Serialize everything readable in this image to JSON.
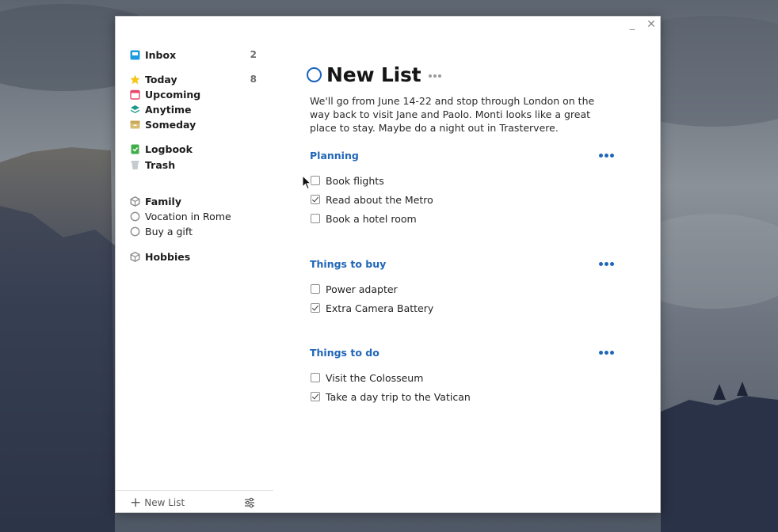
{
  "window": {
    "minimize_glyph": "_",
    "close_glyph": "✕"
  },
  "sidebar": {
    "items": [
      {
        "label": "Inbox",
        "count": "2",
        "icon": "inbox-icon",
        "bold": true
      },
      {
        "label": "Today",
        "count": "8",
        "icon": "star-icon",
        "bold": true
      },
      {
        "label": "Upcoming",
        "count": "",
        "icon": "calendar-icon",
        "bold": true
      },
      {
        "label": "Anytime",
        "count": "",
        "icon": "layers-icon",
        "bold": true
      },
      {
        "label": "Someday",
        "count": "",
        "icon": "archive-box-icon",
        "bold": true
      },
      {
        "label": "Logbook",
        "count": "",
        "icon": "logbook-icon",
        "bold": true
      },
      {
        "label": "Trash",
        "count": "",
        "icon": "trash-icon",
        "bold": true
      },
      {
        "label": "Family",
        "count": "",
        "icon": "area-cube-icon",
        "bold": true
      },
      {
        "label": "Vocation in Rome",
        "count": "",
        "icon": "project-circle-icon",
        "bold": false
      },
      {
        "label": "Buy a gift",
        "count": "",
        "icon": "project-circle-icon",
        "bold": false
      },
      {
        "label": "Hobbies",
        "count": "",
        "icon": "area-cube-icon",
        "bold": true
      }
    ],
    "footer": {
      "new_list_label": "New List",
      "plus_glyph": "+",
      "settings_icon": "sliders-icon"
    }
  },
  "main": {
    "title": "New List",
    "notes": "We'll go from June 14-22 and stop through London on the way back to visit Jane and Paolo. Monti looks like a great place to stay. Maybe do a night out in Trastervere.",
    "headings": [
      {
        "title": "Planning",
        "todos": [
          {
            "label": "Book flights",
            "checked": false
          },
          {
            "label": "Read about the Metro",
            "checked": true
          },
          {
            "label": "Book a hotel room",
            "checked": false
          }
        ]
      },
      {
        "title": "Things to buy",
        "todos": [
          {
            "label": "Power adapter",
            "checked": false
          },
          {
            "label": "Extra Camera Battery",
            "checked": true
          }
        ]
      },
      {
        "title": "Things to do",
        "todos": [
          {
            "label": "Visit the Colosseum",
            "checked": false
          },
          {
            "label": "Take a day trip to the Vatican",
            "checked": true
          }
        ]
      }
    ]
  },
  "colors": {
    "accent": "#1a63bf",
    "heading": "#2166b8",
    "inbox": "#1e9be0",
    "today": "#f5c518",
    "upcoming": "#e8476a",
    "anytime": "#1c9a8c",
    "someday": "#c9a75a",
    "logbook": "#3fae49",
    "trash": "#a9b4bb"
  }
}
